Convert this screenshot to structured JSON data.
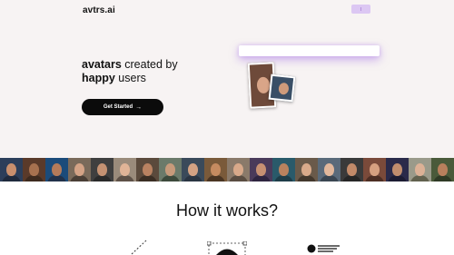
{
  "header": {
    "logo": "avtrs.ai",
    "button_label": ""
  },
  "hero": {
    "headline_bold_1": "avatars",
    "headline_rest_1": " created by",
    "headline_bold_2": "happy",
    "headline_rest_2": " users",
    "cta_label": "Get Started",
    "cta_arrow": "→",
    "input_value": ""
  },
  "strip": {
    "tiles": [
      {
        "bg": "#2c3e5a",
        "face": "#c98f6d",
        "body": "#1f2a3d"
      },
      {
        "bg": "#5a3a2a",
        "face": "#a7714f",
        "body": "#3d2a1f"
      },
      {
        "bg": "#1b4b7a",
        "face": "#b47b5a",
        "body": "#22324a"
      },
      {
        "bg": "#7a6a5a",
        "face": "#d4a386",
        "body": "#4a3f36"
      },
      {
        "bg": "#3f3f3f",
        "face": "#c49172",
        "body": "#2a2a2a"
      },
      {
        "bg": "#9a8b7b",
        "face": "#e0b497",
        "body": "#5e5147"
      },
      {
        "bg": "#5b4a3c",
        "face": "#b98261",
        "body": "#3a2e24"
      },
      {
        "bg": "#6b7a6a",
        "face": "#c79a7b",
        "body": "#3d4a3c"
      },
      {
        "bg": "#3a4a5a",
        "face": "#d3a283",
        "body": "#2a3542"
      },
      {
        "bg": "#7a5a3a",
        "face": "#c68b60",
        "body": "#4a3523"
      },
      {
        "bg": "#8a7a6a",
        "face": "#d8a98a",
        "body": "#5a4d42"
      },
      {
        "bg": "#4a3a5a",
        "face": "#c79072",
        "body": "#2f2540"
      },
      {
        "bg": "#2a5a6a",
        "face": "#b9825e",
        "body": "#1e3d48"
      },
      {
        "bg": "#6a5a4a",
        "face": "#d9aa8a",
        "body": "#43382d"
      },
      {
        "bg": "#5a6a7a",
        "face": "#e2b89c",
        "body": "#3a4652"
      },
      {
        "bg": "#3a3a3a",
        "face": "#c28a69",
        "body": "#262626"
      },
      {
        "bg": "#7a4a3a",
        "face": "#d7a080",
        "body": "#4d2e24"
      },
      {
        "bg": "#2a2a4a",
        "face": "#c08d6e",
        "body": "#1c1c33"
      },
      {
        "bg": "#9a9a8a",
        "face": "#dcb196",
        "body": "#62624f"
      },
      {
        "bg": "#4a5a3a",
        "face": "#b87f5c",
        "body": "#2f3a25"
      }
    ]
  },
  "section": {
    "title": "How it works?"
  }
}
